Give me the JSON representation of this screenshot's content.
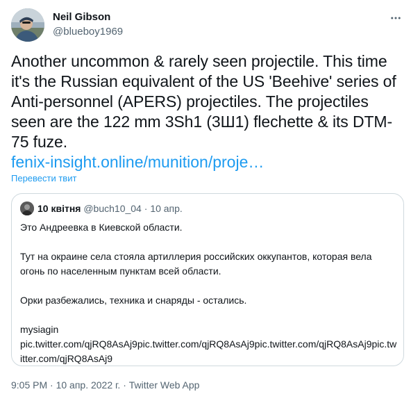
{
  "author": {
    "name": "Neil Gibson",
    "handle": "@blueboy1969"
  },
  "tweet": {
    "text": "Another uncommon & rarely seen projectile. This time it's the Russian equivalent of the US 'Beehive' series of Anti-personnel (APERS) projectiles. The projectiles seen are the 122 mm 3Sh1 (3Ш1) flechette & its DTM-75 fuze.",
    "link": "fenix-insight.online/munition/proje…",
    "translate_label": "Перевести твит"
  },
  "quote": {
    "name": "10 квітня",
    "handle": "@buch10_04",
    "separator": "·",
    "date": "10 апр.",
    "lines": [
      "Это Андреевка в Киевской области.",
      "",
      "Тут на окраине села стояла артиллерия российских оккупантов, которая вела огонь по населенным пунктам всей области.",
      "",
      "Орки разбежались, техника и снаряды - остались.",
      "",
      "mysiagin",
      "pic.twitter.com/qjRQ8AsAj9pic.twitter.com/qjRQ8AsAj9pic.twitter.com/qjRQ8AsAj9pic.twitter.com/qjRQ8AsAj9"
    ]
  },
  "footer": {
    "time": "9:05 PM",
    "date": "10 апр. 2022 г.",
    "separator": "·",
    "source": "Twitter Web App"
  },
  "icons": {
    "more": "more-horizontal-icon"
  },
  "colors": {
    "link": "#1d9bf0",
    "secondary_text": "#536471",
    "border": "#cfd9de"
  }
}
